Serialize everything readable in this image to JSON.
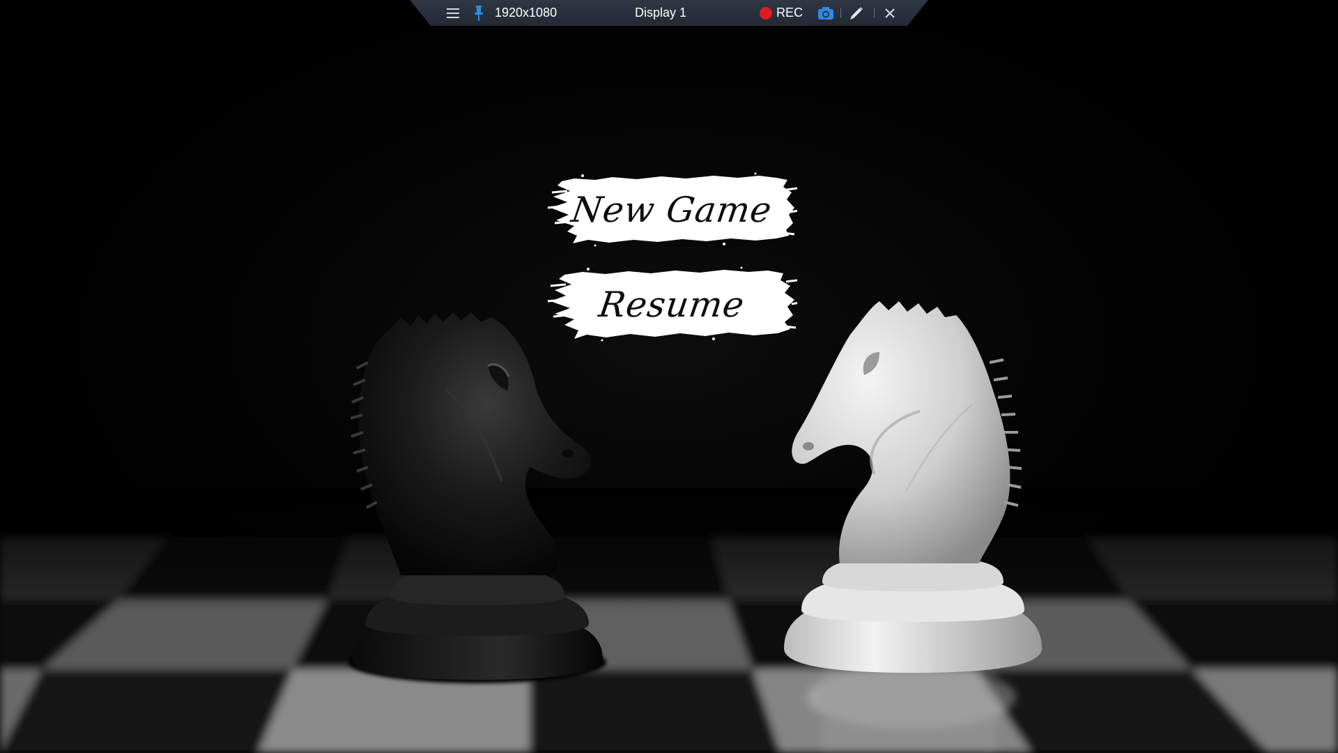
{
  "toolbar": {
    "menu_icon": "hamburger-menu-icon",
    "pin_icon": "pin-icon",
    "resolution": "1920x1080",
    "display_name": "Display 1",
    "record_icon": "record-dot-icon",
    "record_label": "REC",
    "camera_icon": "camera-icon",
    "pen_icon": "pen-icon",
    "close_icon": "close-icon",
    "colors": {
      "background": "#283040",
      "record_red": "#e11b22",
      "accent_blue": "#2f8be6"
    }
  },
  "menu": {
    "new_game_label": "New Game",
    "resume_label": "Resume"
  },
  "scene": {
    "description_icons": [
      "black-knight-piece",
      "white-knight-piece",
      "chessboard"
    ]
  }
}
